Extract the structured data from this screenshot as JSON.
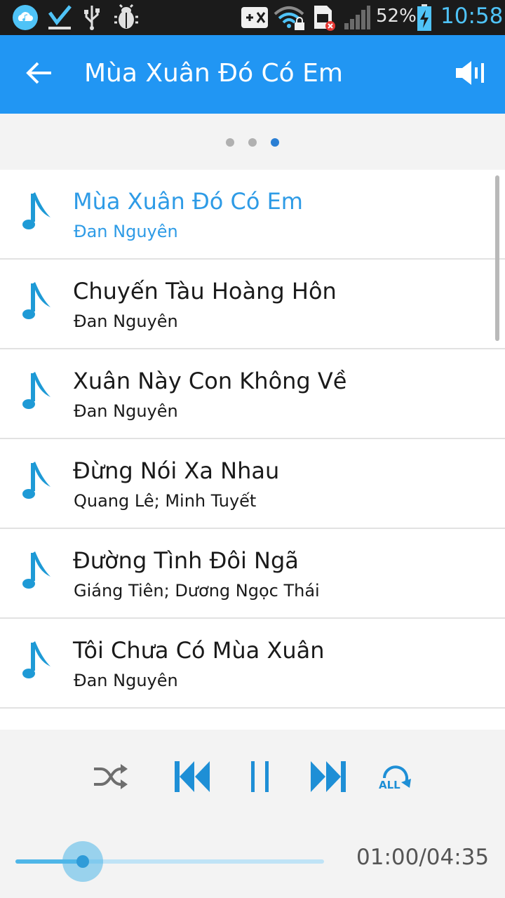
{
  "status_bar": {
    "battery_percent": "52%",
    "time": "10:58",
    "icons": [
      "cloud-music-icon",
      "checkmark-icon",
      "usb-icon",
      "bug-icon",
      "gamepad-icon",
      "wifi-lock-icon",
      "sim-error-icon",
      "signal-icon",
      "battery-charging-icon"
    ]
  },
  "app_bar": {
    "title": "Mùa Xuân Đó Có Em",
    "back_icon": "arrow-left-icon",
    "volume_icon": "volume-icon",
    "color": "#2196f3"
  },
  "pager": {
    "count": 3,
    "active_index": 2
  },
  "songs": [
    {
      "title": "Mùa Xuân Đó Có Em",
      "artist": "Đan Nguyên",
      "current": true
    },
    {
      "title": "Chuyến Tàu Hoàng Hôn",
      "artist": "Đan Nguyên",
      "current": false
    },
    {
      "title": "Xuân Này Con Không Về",
      "artist": "Đan Nguyên",
      "current": false
    },
    {
      "title": "Đừng Nói Xa Nhau",
      "artist": "Quang Lê; Minh Tuyết",
      "current": false
    },
    {
      "title": "Đường Tình Đôi Ngã",
      "artist": "Giáng Tiên; Dương Ngọc Thái",
      "current": false
    },
    {
      "title": "Tôi Chưa Có Mùa Xuân",
      "artist": "Đan Nguyên",
      "current": false
    }
  ],
  "player": {
    "shuffle_icon": "shuffle-icon",
    "previous_icon": "skip-previous-icon",
    "pause_icon": "pause-icon",
    "next_icon": "skip-next-icon",
    "repeat_icon": "repeat-all-icon",
    "repeat_label": "ALL",
    "time_readout": "01:00/04:35",
    "progress": 0.218,
    "accent": "#1e8fd6"
  }
}
